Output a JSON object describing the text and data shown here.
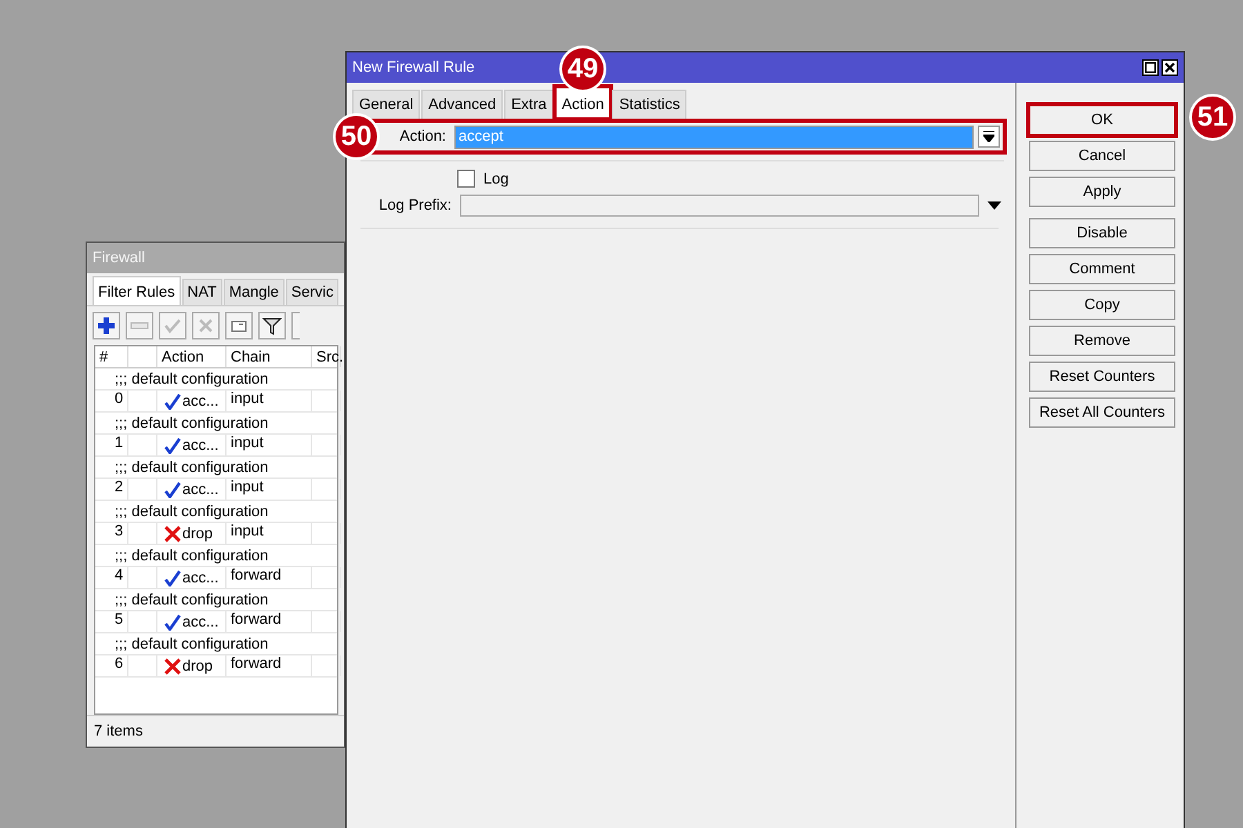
{
  "firewall_window": {
    "title": "Firewall",
    "tabs": [
      {
        "label": "Filter Rules",
        "selected": true
      },
      {
        "label": "NAT",
        "selected": false
      },
      {
        "label": "Mangle",
        "selected": false
      },
      {
        "label": "Servic",
        "selected": false
      }
    ],
    "columns": [
      {
        "label": "#"
      },
      {
        "label": "Action"
      },
      {
        "label": "Chain"
      },
      {
        "label": "Src."
      }
    ],
    "rows": [
      {
        "comment": ";;; default configuration",
        "number": "0",
        "kind": "accept",
        "action": "acc...",
        "chain": "input"
      },
      {
        "comment": ";;; default configuration",
        "number": "1",
        "kind": "accept",
        "action": "acc...",
        "chain": "input"
      },
      {
        "comment": ";;; default configuration",
        "number": "2",
        "kind": "accept",
        "action": "acc...",
        "chain": "input"
      },
      {
        "comment": ";;; default configuration",
        "number": "3",
        "kind": "drop",
        "action": "drop",
        "chain": "input"
      },
      {
        "comment": ";;; default configuration",
        "number": "4",
        "kind": "accept",
        "action": "acc...",
        "chain": "forward"
      },
      {
        "comment": ";;; default configuration",
        "number": "5",
        "kind": "accept",
        "action": "acc...",
        "chain": "forward"
      },
      {
        "comment": ";;; default configuration",
        "number": "6",
        "kind": "drop",
        "action": "drop",
        "chain": "forward"
      }
    ],
    "status": "7 items"
  },
  "dialog": {
    "title": "New Firewall Rule",
    "tabs": [
      {
        "label": "General",
        "selected": false
      },
      {
        "label": "Advanced",
        "selected": false
      },
      {
        "label": "Extra",
        "selected": false
      },
      {
        "label": "Action",
        "selected": true,
        "callout": "49"
      },
      {
        "label": "Statistics",
        "selected": false
      }
    ],
    "action_field": {
      "label": "Action:",
      "value": "accept",
      "callout": "50"
    },
    "log": {
      "label": "Log",
      "checked": false
    },
    "log_prefix": {
      "label": "Log Prefix:"
    },
    "button_groups": [
      [
        {
          "label": "OK",
          "callout": "51"
        },
        {
          "label": "Cancel"
        },
        {
          "label": "Apply"
        }
      ],
      [
        {
          "label": "Disable"
        },
        {
          "label": "Comment"
        },
        {
          "label": "Copy"
        },
        {
          "label": "Remove"
        },
        {
          "label": "Reset Counters"
        },
        {
          "label": "Reset All Counters"
        }
      ]
    ]
  }
}
